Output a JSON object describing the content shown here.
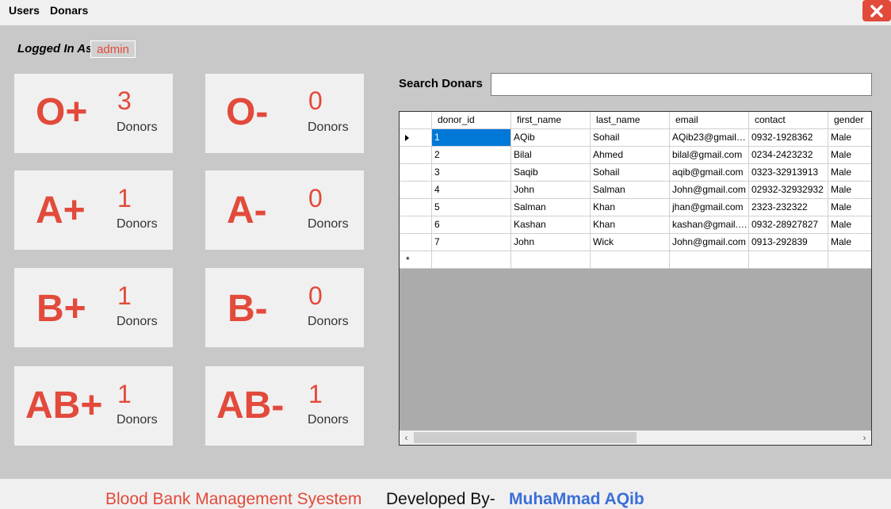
{
  "menu": {
    "users": "Users",
    "donars": "Donars"
  },
  "login": {
    "label": "Logged In As",
    "user": "admin"
  },
  "cards": [
    {
      "group": "O+",
      "count": "3",
      "label": "Donors"
    },
    {
      "group": "O-",
      "count": "0",
      "label": "Donors"
    },
    {
      "group": "A+",
      "count": "1",
      "label": "Donors"
    },
    {
      "group": "A-",
      "count": "0",
      "label": "Donors"
    },
    {
      "group": "B+",
      "count": "1",
      "label": "Donors"
    },
    {
      "group": "B-",
      "count": "0",
      "label": "Donors"
    },
    {
      "group": "AB+",
      "count": "1",
      "label": "Donors"
    },
    {
      "group": "AB-",
      "count": "1",
      "label": "Donors"
    }
  ],
  "search": {
    "label": "Search Donars",
    "value": ""
  },
  "grid": {
    "columns": [
      "donor_id",
      "first_name",
      "last_name",
      "email",
      "contact",
      "gender"
    ],
    "rows": [
      [
        "1",
        "AQib",
        "Sohail",
        "AQib23@gmail.c...",
        "0932-1928362",
        "Male"
      ],
      [
        "2",
        "Bilal",
        "Ahmed",
        "bilal@gmail.com",
        "0234-2423232",
        "Male"
      ],
      [
        "3",
        "Saqib",
        "Sohail",
        "aqib@gmail.com",
        "0323-32913913",
        "Male"
      ],
      [
        "4",
        "John",
        "Salman",
        "John@gmail.com",
        "02932-32932932",
        "Male"
      ],
      [
        "5",
        "Salman",
        "Khan",
        "jhan@gmail.com",
        "2323-232322",
        "Male"
      ],
      [
        "6",
        "Kashan",
        "Khan",
        "kashan@gmail.c...",
        "0932-28927827",
        "Male"
      ],
      [
        "7",
        "John",
        "Wick",
        "John@gmail.com",
        "0913-292839",
        "Male"
      ]
    ],
    "new_row_marker": "*"
  },
  "footer": {
    "title": "Blood Bank Management Syestem",
    "developed_by": "Developed By-",
    "author": "MuhaMmad AQib"
  },
  "colors": {
    "accent": "#e24a3b",
    "author": "#3a6fd8",
    "selection": "#0078d7"
  }
}
